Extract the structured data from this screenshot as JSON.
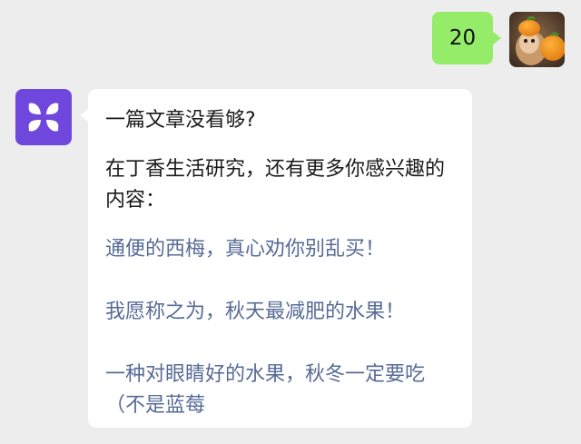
{
  "messages": {
    "outgoing": {
      "text": "20",
      "bubble_color": "#95ec69"
    },
    "incoming": {
      "intro": "一篇文章没看够?",
      "promo": "在丁香生活研究，还有更多你感兴趣的内容：",
      "links": [
        "通便的西梅，真心劝你别乱买！",
        "我愿称之为，秋天最减肥的水果！",
        "一种对眼睛好的水果，秋冬一定要吃（不是蓝莓"
      ],
      "link_color": "#576b95",
      "avatar_icon": "four-petal-flower-icon",
      "avatar_color": "#6f47dc"
    }
  }
}
